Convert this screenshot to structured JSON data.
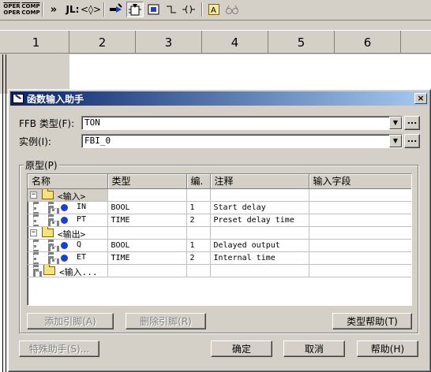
{
  "toolbar": {
    "oper": [
      "OPER",
      "OPER"
    ],
    "comp": [
      "COMP",
      "COMP"
    ],
    "jl": "JL:",
    "items": [
      "double-chevron-icon",
      "jl-icon",
      "diamond-icon",
      "insert-icon",
      "function-block-icon",
      "timer-icon",
      "branch-icon",
      "coil-icon",
      "text-icon",
      "glasses-icon"
    ]
  },
  "columns": [
    "1",
    "2",
    "3",
    "4",
    "5",
    "6"
  ],
  "dialog": {
    "title": "函数输入助手",
    "close": "×",
    "ffb_type_label": "FFB 类型(F):",
    "ffb_type_value": "TON",
    "instance_label": "实例(I):",
    "instance_value": "FBI_0",
    "ellipsis": "...",
    "prototype_label": "原型(P)",
    "headers": [
      "名称",
      "类型",
      "编.",
      "注释",
      "输入字段"
    ],
    "rows": [
      {
        "kind": "group",
        "name": "<输入>",
        "type": "",
        "num": "",
        "comment": "",
        "field": ""
      },
      {
        "kind": "pin",
        "name": "IN",
        "type": "BOOL",
        "num": "1",
        "comment": "Start delay",
        "field": ""
      },
      {
        "kind": "pin",
        "name": "PT",
        "type": "TIME",
        "num": "2",
        "comment": "Preset delay time",
        "field": ""
      },
      {
        "kind": "group",
        "name": "<输出>",
        "type": "",
        "num": "",
        "comment": "",
        "field": ""
      },
      {
        "kind": "pin",
        "name": "Q",
        "type": "BOOL",
        "num": "1",
        "comment": "Delayed output",
        "field": ""
      },
      {
        "kind": "pin",
        "name": "ET",
        "type": "TIME",
        "num": "2",
        "comment": "Internal time",
        "field": ""
      },
      {
        "kind": "folder",
        "name": "<输入...",
        "type": "",
        "num": "",
        "comment": "",
        "field": ""
      }
    ],
    "add_pin": "添加引脚(A)",
    "remove_pin": "删除引脚(R)",
    "type_help": "类型帮助(T)",
    "special_assistant": "特殊助手(S)...",
    "ok": "确定",
    "cancel": "取消",
    "help": "帮助(H)"
  }
}
